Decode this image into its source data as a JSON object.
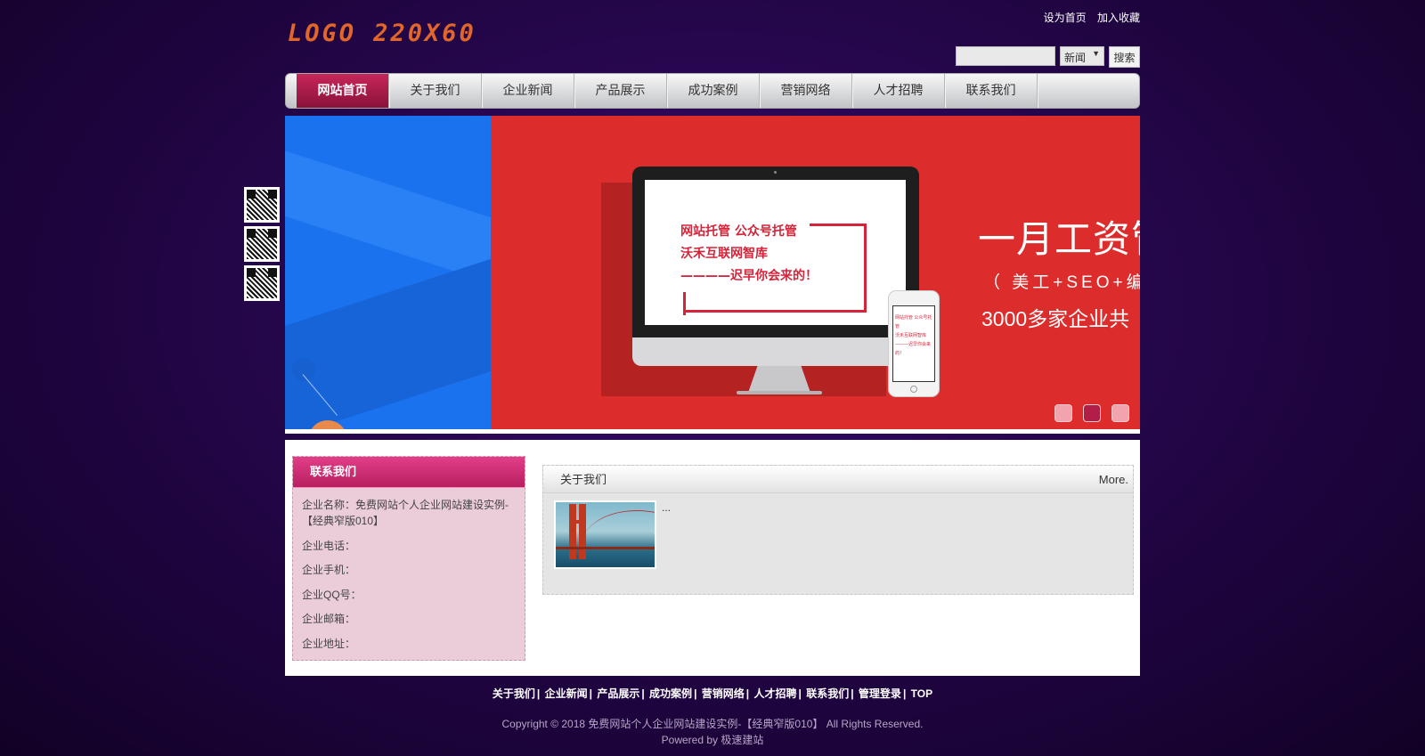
{
  "header": {
    "logo_text": "LOGO 220X60",
    "top_links": [
      "设为首页",
      "加入收藏"
    ],
    "search": {
      "input_value": "",
      "select_value": "新闻",
      "button_label": "搜索"
    }
  },
  "nav": {
    "items": [
      "网站首页",
      "关于我们",
      "企业新闻",
      "产品展示",
      "成功案例",
      "营销网络",
      "人才招聘",
      "联系我们"
    ],
    "active_index": 0
  },
  "banner": {
    "screen_lines": [
      "网站托管  公众号托管",
      "沃禾互联网智库",
      "————迟早你会来的！"
    ],
    "phone_lines": [
      "网站托管 公众号托管",
      "沃禾互联网智库",
      "———迟早你会来的！"
    ],
    "slogan_big": "一月工资管",
    "slogan_mid": "（ 美工+SEO+编",
    "slogan_small": "3000多家企业共",
    "slide_count": 3,
    "active_slide": 1,
    "colors": {
      "red": "#dd2c2c",
      "blue": "#1b72ee"
    }
  },
  "contact": {
    "title": "联系我们",
    "rows": [
      "企业名称：免费网站个人企业网站建设实例-【经典窄版010】",
      "企业电话：",
      "企业手机：",
      "企业QQ号：",
      "企业邮箱：",
      "企业地址："
    ]
  },
  "about": {
    "title": "关于我们",
    "more_label": "More.",
    "summary": "..."
  },
  "qr_codes": [
    "qr-code-icon",
    "qr-code-icon",
    "qr-code-icon"
  ],
  "footer": {
    "links": [
      "关于我们",
      "企业新闻",
      "产品展示",
      "成功案例",
      "营销网络",
      "人才招聘",
      "联系我们",
      "管理登录",
      "TOP"
    ],
    "separator": "|",
    "copyright": "Copyright © 2018 免费网站个人企业网站建设实例-【经典窄版010】 All Rights Reserved.",
    "powered": "Powered by 极速建站"
  }
}
